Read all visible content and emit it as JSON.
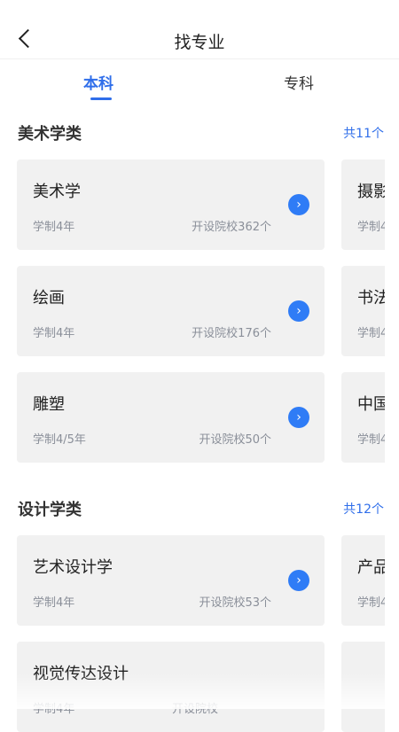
{
  "header": {
    "title": "找专业"
  },
  "tabs": [
    {
      "label": "本科",
      "active": true
    },
    {
      "label": "专科",
      "active": false
    }
  ],
  "sections": [
    {
      "title": "美术学类",
      "count": "共11个",
      "cards": [
        {
          "name": "美术学",
          "duration": "学制4年",
          "schools": "开设院校362个"
        },
        {
          "name": "绘画",
          "duration": "学制4年",
          "schools": "开设院校176个"
        },
        {
          "name": "雕塑",
          "duration": "学制4/5年",
          "schools": "开设院校50个"
        }
      ],
      "peek": [
        {
          "name": "摄影",
          "sub": "学制4"
        },
        {
          "name": "书法",
          "sub": "学制4"
        },
        {
          "name": "中国",
          "sub": "学制4"
        }
      ]
    },
    {
      "title": "设计学类",
      "count": "共12个",
      "cards": [
        {
          "name": "艺术设计学",
          "duration": "学制4年",
          "schools": "开设院校53个"
        },
        {
          "name": "视觉传达设计",
          "duration": "学制4年",
          "schools": "开设院校"
        }
      ],
      "peek": [
        {
          "name": "产品",
          "sub": "学制4"
        }
      ]
    }
  ],
  "icons": {
    "back": "chevron-left-icon",
    "arrow": "chevron-right-icon"
  },
  "colors": {
    "accent": "#2f6eea",
    "card_bg": "#f1f1f1"
  }
}
